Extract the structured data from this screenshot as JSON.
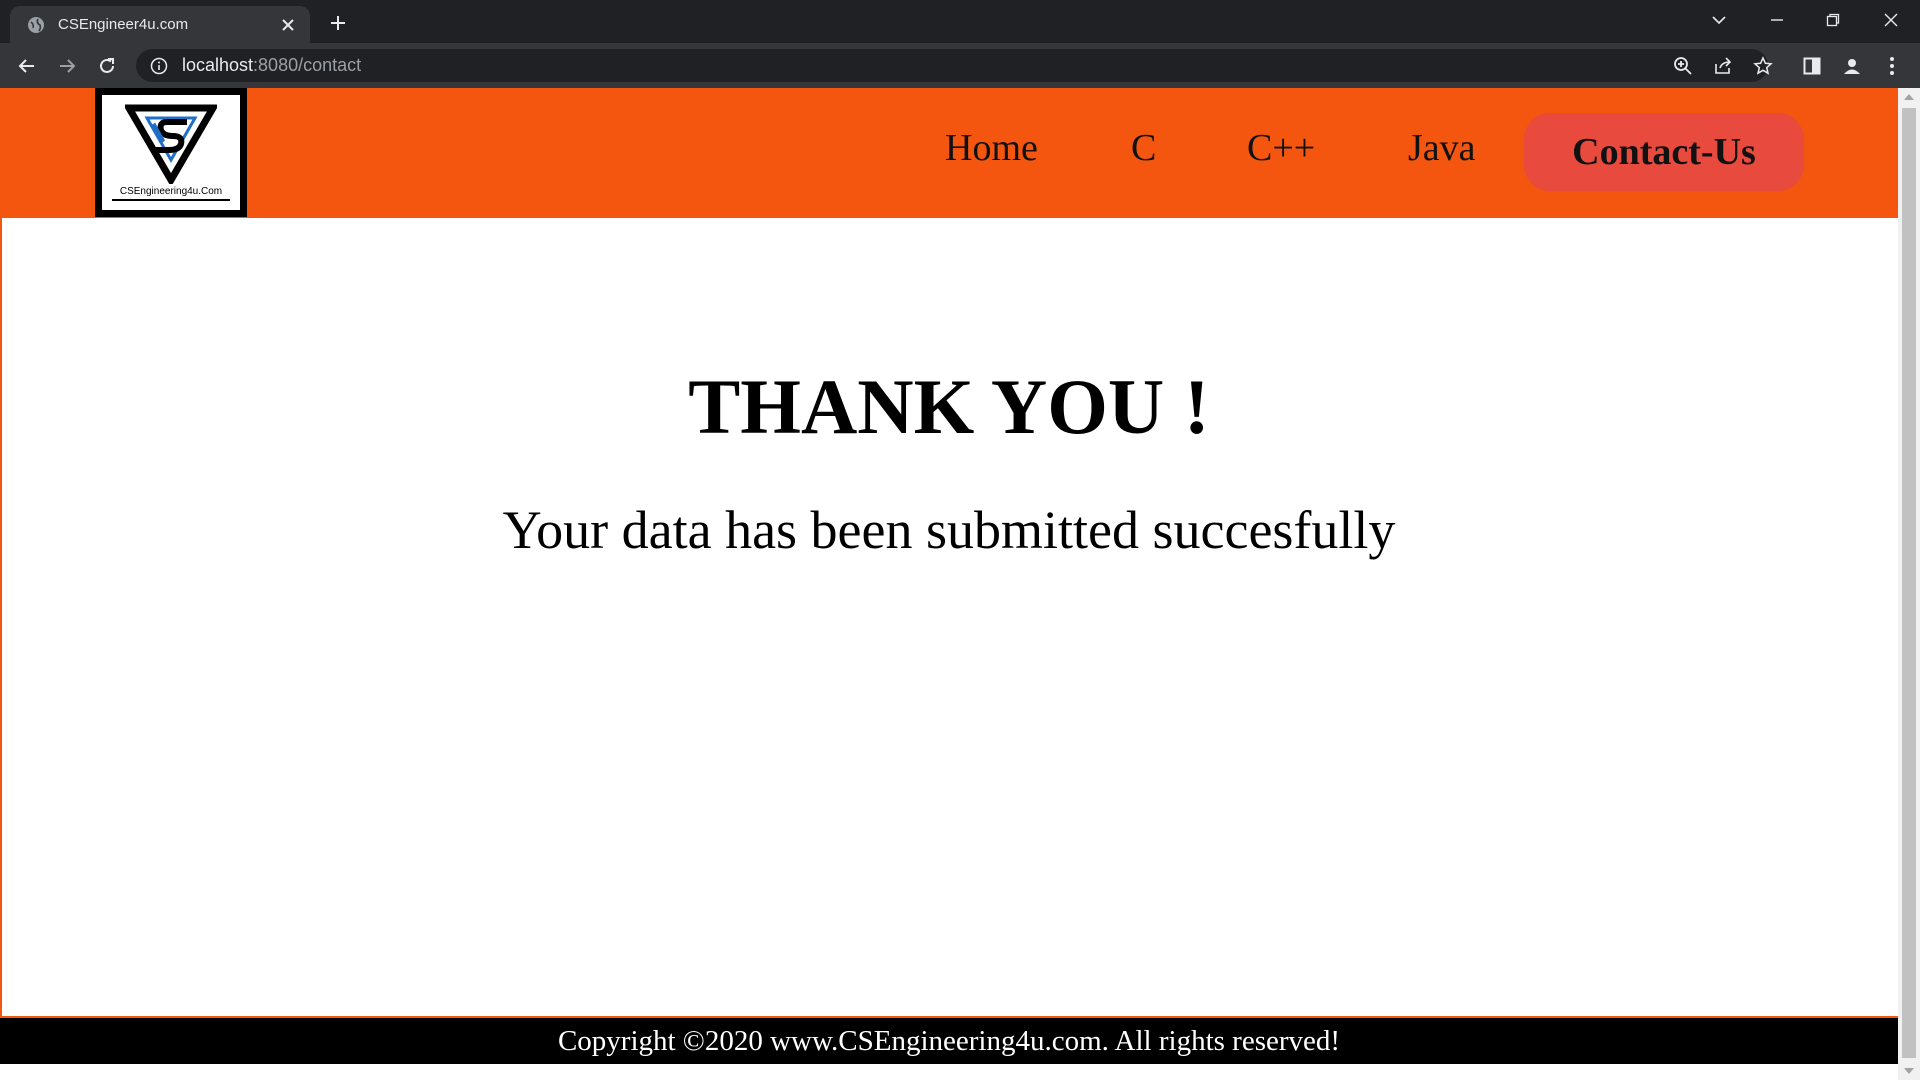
{
  "browser": {
    "tab_title": "CSEngineer4u.com",
    "url_host": "localhost",
    "url_path": ":8080/contact"
  },
  "site": {
    "logo_text": "CSEngineering4u.Com",
    "nav": [
      {
        "label": "Home"
      },
      {
        "label": "C"
      },
      {
        "label": "C++"
      },
      {
        "label": "Java"
      }
    ],
    "contact_label": "Contact-Us"
  },
  "main": {
    "heading": "THANK YOU !",
    "message": "Your data has been submitted succesfully"
  },
  "footer": {
    "text": "Copyright ©2020 www.CSEngineering4u.com. All rights reserved!"
  },
  "colors": {
    "header_bg": "#f4560f",
    "contact_button_bg": "#e84a3e",
    "footer_bg": "#000000"
  },
  "icons": [
    "globe-favicon-icon",
    "close-icon",
    "plus-icon",
    "chevron-down-icon",
    "minimize-icon",
    "restore-icon",
    "window-close-icon",
    "back-arrow-icon",
    "forward-arrow-icon",
    "reload-icon",
    "info-icon",
    "zoom-icon",
    "share-icon",
    "star-icon",
    "side-panel-icon",
    "profile-icon",
    "kebab-menu-icon"
  ]
}
